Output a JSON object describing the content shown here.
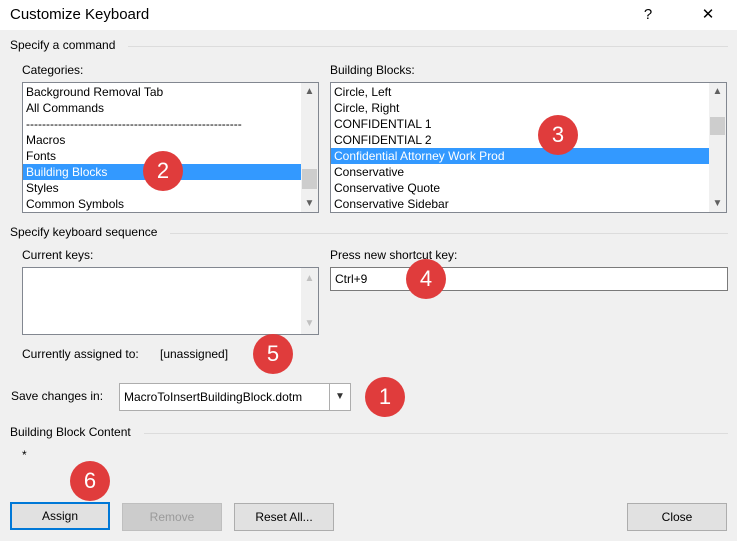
{
  "window": {
    "title": "Customize Keyboard",
    "help_label": "?",
    "close_label": "✕"
  },
  "specify_command": {
    "label": "Specify a command",
    "categories_label": "Categories:",
    "categories": [
      "Background Removal Tab",
      "All Commands",
      "------------------------------------------------------",
      "Macros",
      "Fonts",
      "Building Blocks",
      "Styles",
      "Common Symbols"
    ],
    "categories_selected_index": 5,
    "building_blocks_label": "Building Blocks:",
    "building_blocks": [
      "Circle, Left",
      "Circle, Right",
      "CONFIDENTIAL 1",
      "CONFIDENTIAL 2",
      "Confidential Attorney Work Prod",
      "Conservative",
      "Conservative Quote",
      "Conservative Sidebar"
    ],
    "building_blocks_selected_index": 4
  },
  "keyboard_sequence": {
    "label": "Specify keyboard sequence",
    "current_keys_label": "Current keys:",
    "press_new_label": "Press new shortcut key:",
    "new_shortcut_value": "Ctrl+9",
    "currently_assigned_label": "Currently assigned to:",
    "currently_assigned_value": "[unassigned]"
  },
  "save_changes": {
    "label": "Save changes in:",
    "value": "MacroToInsertBuildingBlock.dotm"
  },
  "building_block_content": {
    "label": "Building Block Content",
    "value": "*"
  },
  "buttons": {
    "assign": "Assign",
    "remove": "Remove",
    "reset_all": "Reset All...",
    "close": "Close"
  },
  "callouts": [
    "1",
    "2",
    "3",
    "4",
    "5",
    "6"
  ],
  "colors": {
    "selection": "#3399ff",
    "callout": "#e03c3c",
    "default_button_border": "#0078d7"
  }
}
